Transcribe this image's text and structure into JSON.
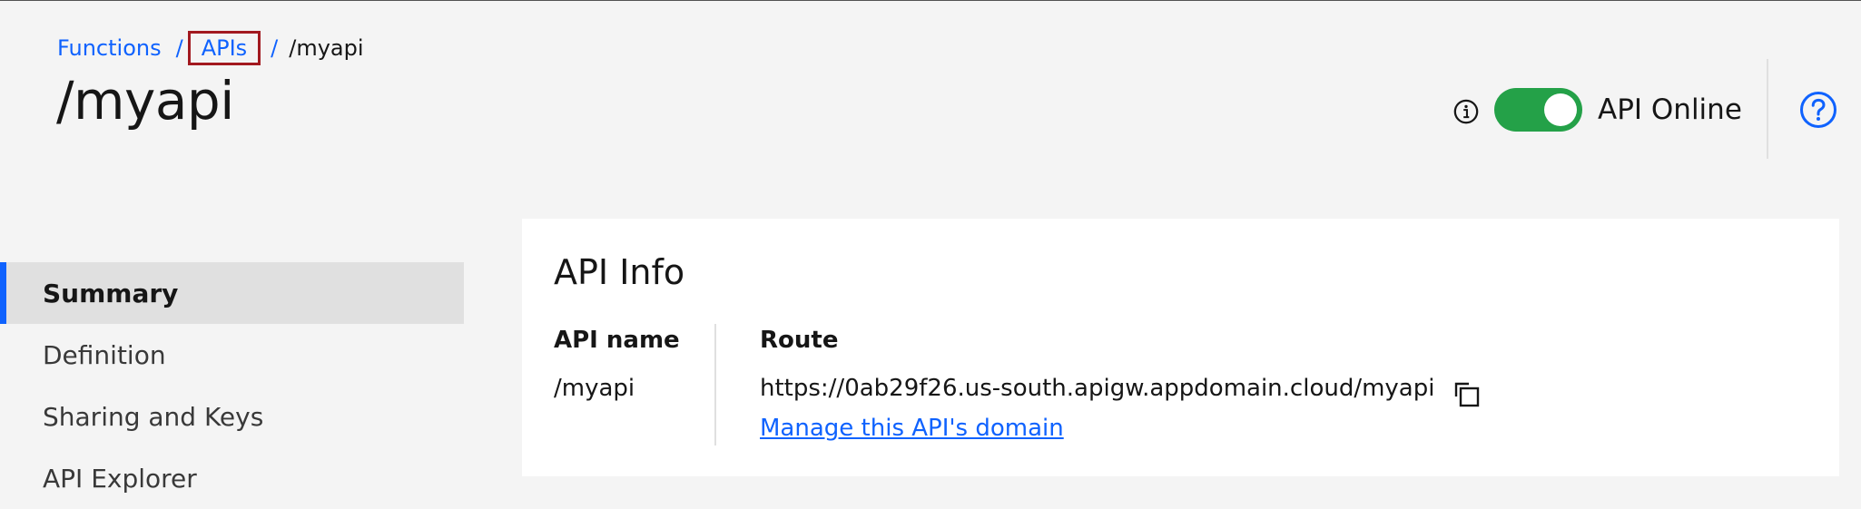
{
  "breadcrumb": {
    "items": [
      "Functions",
      "APIs"
    ],
    "separator": "/",
    "current": "/myapi"
  },
  "page": {
    "title": "/myapi"
  },
  "header": {
    "info_icon": "info-icon",
    "toggle": {
      "label": "API Online",
      "state": "on",
      "color": "#24a148"
    },
    "help_icon": "help-icon"
  },
  "sidebar": {
    "active_color": "#0f62fe",
    "items": [
      {
        "label": "Summary",
        "active": true
      },
      {
        "label": "Definition",
        "active": false
      },
      {
        "label": "Sharing and Keys",
        "active": false
      },
      {
        "label": "API Explorer",
        "active": false
      }
    ]
  },
  "api_info": {
    "title": "API Info",
    "api_name_label": "API name",
    "api_name_value": "/myapi",
    "route_label": "Route",
    "route_value": "https://0ab29f26.us-south.apigw.appdomain.cloud/myapi",
    "copy_icon": "copy-icon",
    "domain_link": "Manage this API's domain"
  },
  "colors": {
    "link": "#0f62fe",
    "highlight_box": "#a2191f",
    "background": "#f4f4f4"
  }
}
